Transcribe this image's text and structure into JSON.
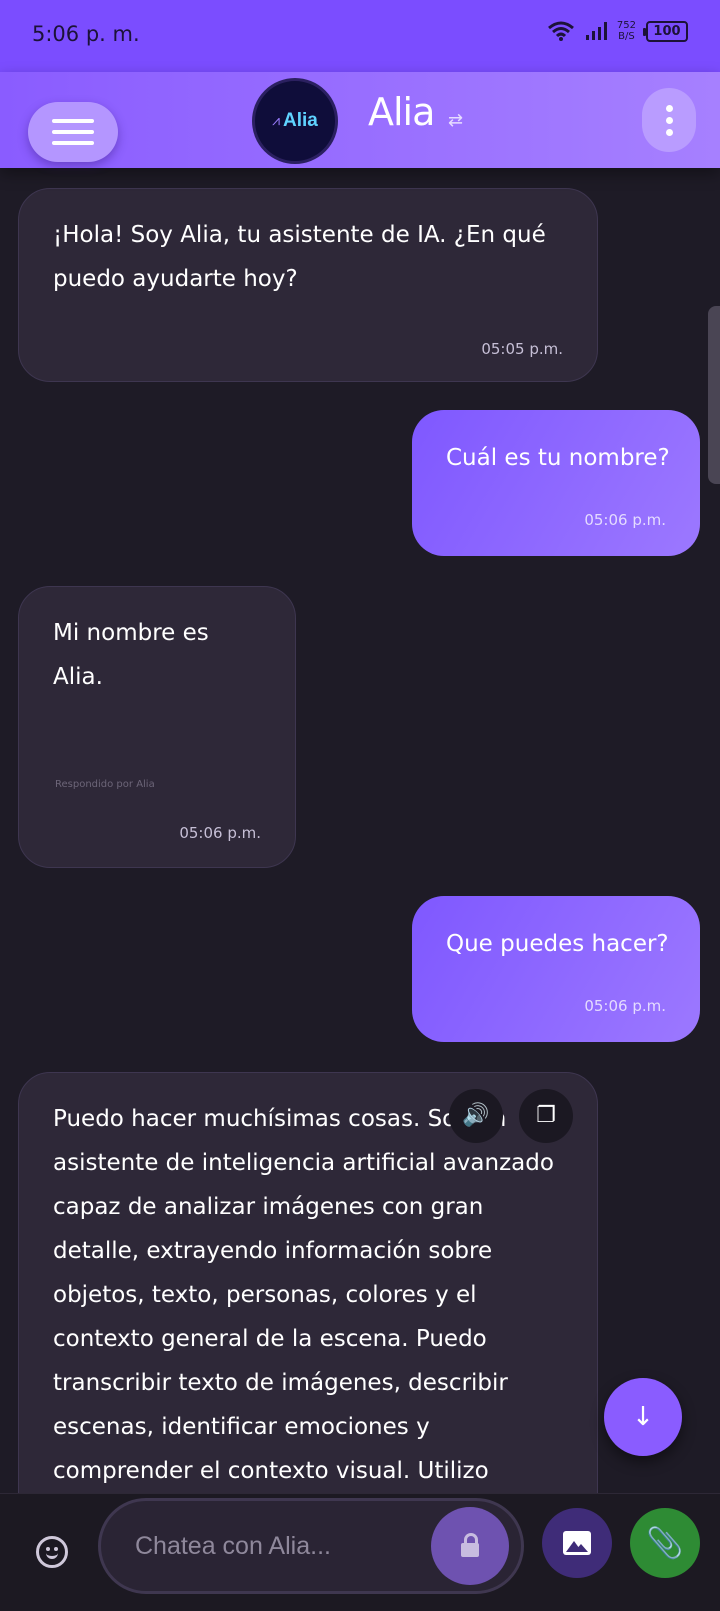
{
  "status_bar": {
    "time": "5:06 p. m.",
    "net_speed_value": "752",
    "net_speed_unit": "B/S",
    "battery": "100",
    "icons": [
      "wifi-icon",
      "signal-icon",
      "battery-icon"
    ]
  },
  "header": {
    "avatar_text": "Alia",
    "avatar_logo": "⩘",
    "title": "Alia",
    "swap_icon": "⇄",
    "icons": [
      "menu-icon",
      "swap-icon",
      "more-vertical-icon"
    ]
  },
  "messages": [
    {
      "role": "bot",
      "text": "¡Hola! Soy Alia, tu asistente de IA. ¿En qué puedo ayudarte hoy?",
      "time": "05:05 p.m."
    },
    {
      "role": "user",
      "text": "Cuál es tu nombre?",
      "time": "05:06 p.m."
    },
    {
      "role": "bot",
      "text": "Mi nombre es Alia.",
      "sub": "Respondido por Alia",
      "time": "05:06 p.m."
    },
    {
      "role": "user",
      "text": "Que puedes hacer?",
      "time": "05:06 p.m."
    },
    {
      "role": "bot",
      "text": "Puedo hacer muchísimas cosas. Soy un asistente de inteligencia artificial avanzado capaz de analizar imágenes con gran detalle, extrayendo información sobre objetos, texto, personas, colores y el contexto general de la escena. Puedo transcribir texto de imágenes, describir escenas, identificar emociones y comprender el contexto visual. Utilizo Gemini Vision para mi"
    }
  ],
  "message_actions": {
    "speak_icon": "🔊",
    "copy_icon": "❐"
  },
  "scroll_fab": {
    "icon": "↓"
  },
  "composer": {
    "placeholder": "Chatea con Alia...",
    "value": "",
    "clip_icon": "📎",
    "icons": [
      "emoji-icon",
      "lock-icon",
      "image-icon",
      "attach-icon"
    ]
  },
  "colors": {
    "accent": "#7b4dff",
    "background": "#1e1b26",
    "bot_bubble": "#2e2838",
    "attach_button": "#2e8b34"
  }
}
